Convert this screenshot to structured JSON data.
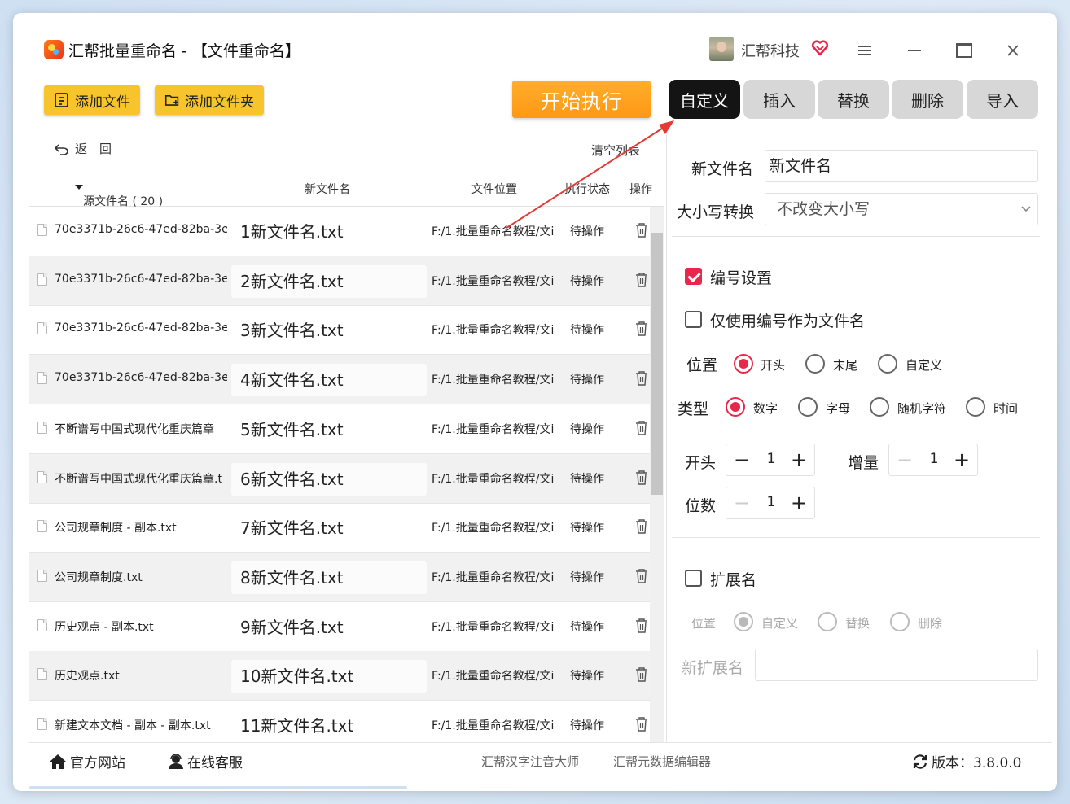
{
  "window": {
    "title": "汇帮批量重命名 - 【文件重命名】",
    "username": "汇帮科技"
  },
  "toolbar": {
    "add_file": "添加文件",
    "add_folder": "添加文件夹",
    "start": "开始执行"
  },
  "tabs": [
    {
      "label": "自定义",
      "active": true
    },
    {
      "label": "插入",
      "active": false
    },
    {
      "label": "替换",
      "active": false
    },
    {
      "label": "删除",
      "active": false
    },
    {
      "label": "导入",
      "active": false
    }
  ],
  "list": {
    "back": "返　回",
    "clear": "清空列表",
    "headers": {
      "source": "源文件名 ( 20 )",
      "new_name": "新文件名",
      "location": "文件位置",
      "status": "执行状态",
      "action": "操作"
    },
    "rows": [
      {
        "source": "70e3371b-26c6-47ed-82ba-3e",
        "new_name": "1新文件名.txt",
        "location": "F:/1.批量重命名教程/文i",
        "status": "待操作"
      },
      {
        "source": "70e3371b-26c6-47ed-82ba-3e",
        "new_name": "2新文件名.txt",
        "location": "F:/1.批量重命名教程/文i",
        "status": "待操作"
      },
      {
        "source": "70e3371b-26c6-47ed-82ba-3e",
        "new_name": "3新文件名.txt",
        "location": "F:/1.批量重命名教程/文i",
        "status": "待操作"
      },
      {
        "source": "70e3371b-26c6-47ed-82ba-3e",
        "new_name": "4新文件名.txt",
        "location": "F:/1.批量重命名教程/文i",
        "status": "待操作"
      },
      {
        "source": "不断谱写中国式现代化重庆篇章",
        "new_name": "5新文件名.txt",
        "location": "F:/1.批量重命名教程/文i",
        "status": "待操作"
      },
      {
        "source": "不断谱写中国式现代化重庆篇章.t",
        "new_name": "6新文件名.txt",
        "location": "F:/1.批量重命名教程/文i",
        "status": "待操作"
      },
      {
        "source": "公司规章制度 - 副本.txt",
        "new_name": "7新文件名.txt",
        "location": "F:/1.批量重命名教程/文i",
        "status": "待操作"
      },
      {
        "source": "公司规章制度.txt",
        "new_name": "8新文件名.txt",
        "location": "F:/1.批量重命名教程/文i",
        "status": "待操作"
      },
      {
        "source": "历史观点 - 副本.txt",
        "new_name": "9新文件名.txt",
        "location": "F:/1.批量重命名教程/文i",
        "status": "待操作"
      },
      {
        "source": "历史观点.txt",
        "new_name": "10新文件名.txt",
        "location": "F:/1.批量重命名教程/文i",
        "status": "待操作"
      },
      {
        "source": "新建文本文档 - 副本 - 副本.txt",
        "new_name": "11新文件名.txt",
        "location": "F:/1.批量重命名教程/文i",
        "status": "待操作"
      }
    ]
  },
  "panel": {
    "new_name_label": "新文件名",
    "new_name_value": "新文件名",
    "case_label": "大小写转换",
    "case_value": "不改变大小写",
    "numbering_label": "编号设置",
    "numbering_checked": true,
    "only_number_label": "仅使用编号作为文件名",
    "only_number_checked": false,
    "position_label": "位置",
    "position_options": [
      "开头",
      "末尾",
      "自定义"
    ],
    "position_selected": "开头",
    "type_label": "类型",
    "type_options": [
      "数字",
      "字母",
      "随机字符",
      "时间"
    ],
    "type_selected": "数字",
    "start_label": "开头",
    "start_value": "1",
    "increment_label": "增量",
    "increment_value": "1",
    "digits_label": "位数",
    "digits_value": "1",
    "extension_label": "扩展名",
    "extension_checked": false,
    "ext_position_label": "位置",
    "ext_options": [
      "自定义",
      "替换",
      "删除"
    ],
    "ext_selected": "自定义",
    "new_ext_label": "新扩展名",
    "new_ext_value": ""
  },
  "footer": {
    "website": "官方网站",
    "support": "在线客服",
    "link1": "汇帮汉字注音大师",
    "link2": "汇帮元数据编辑器",
    "version": "版本：3.8.0.0"
  },
  "colors": {
    "accent": "#e8274b",
    "start_button": "#ff9d1c",
    "add_button": "#f7c52b",
    "active_tab": "#141414"
  }
}
